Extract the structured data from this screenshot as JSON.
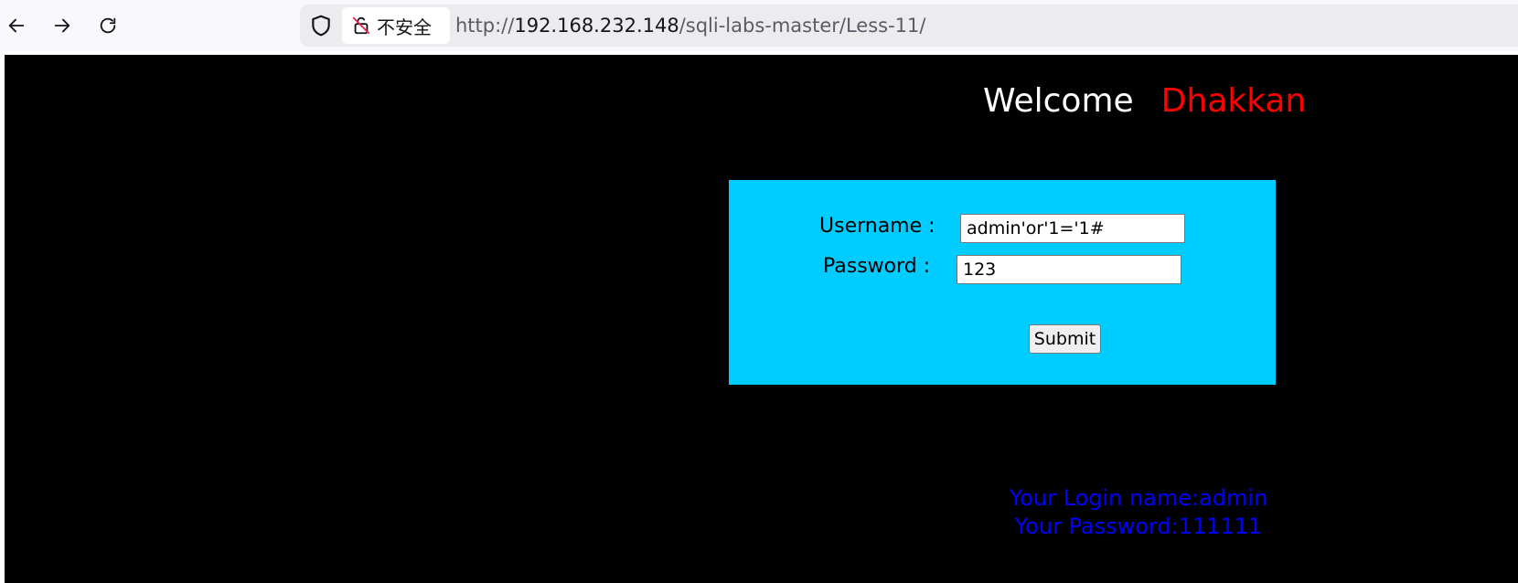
{
  "browser": {
    "back_icon": "arrow-left-icon",
    "forward_icon": "arrow-right-icon",
    "reload_icon": "reload-icon",
    "shield_icon": "shield-icon",
    "insecure_icon": "lock-slash-icon",
    "insecure_label": "不安全",
    "url_scheme": "http://",
    "url_host": "192.168.232.148",
    "url_path": "/sqli-labs-master/Less-11/"
  },
  "page": {
    "background": "#000000",
    "welcome_text": "Welcome",
    "welcome_name": "Dhakkan",
    "welcome_name_color": "#ff0000",
    "form": {
      "background": "#00ccff",
      "username_label": "Username :",
      "username_value": "admin'or'1='1#",
      "password_label": "Password :",
      "password_value": "123",
      "submit_label": "Submit"
    },
    "result": {
      "color": "#0000ff",
      "login_name": "Your Login name:admin",
      "password": "Your Password:111111"
    }
  }
}
